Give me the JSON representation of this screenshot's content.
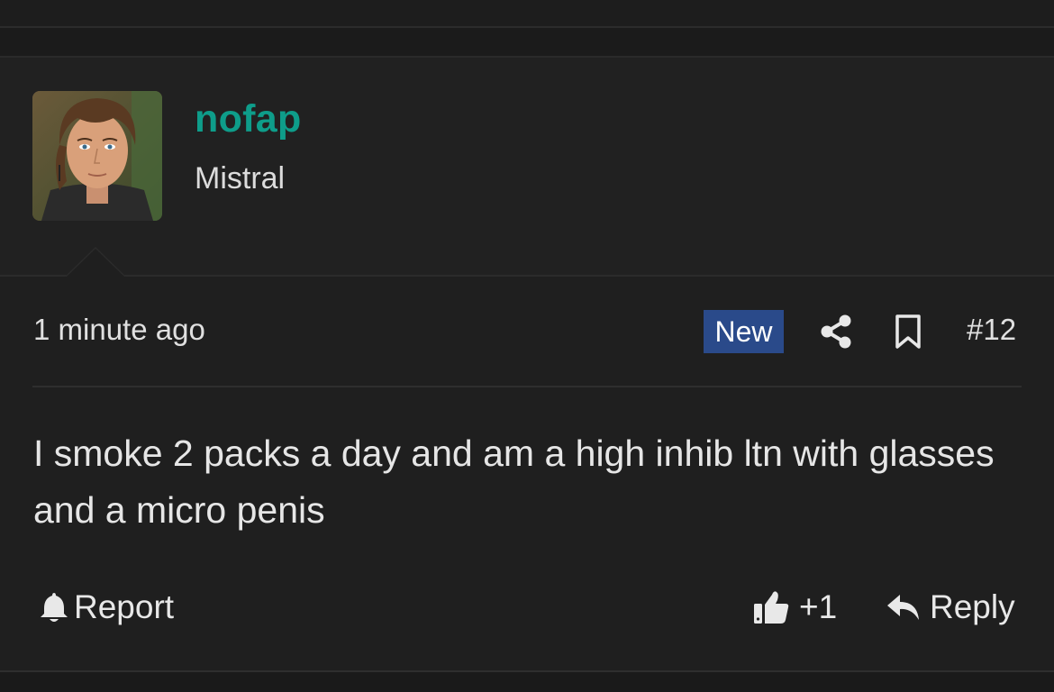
{
  "post": {
    "author": {
      "username": "nofap",
      "user_title": "Mistral",
      "avatar": "profile-photo"
    },
    "timestamp": "1 minute ago",
    "badge": "New",
    "post_number": "#12",
    "body": "I smoke 2 packs a day and am a high inhib ltn with glasses and a micro penis",
    "actions": {
      "report_label": "Report",
      "like_count": "+1",
      "reply_label": "Reply"
    }
  },
  "icons": {
    "share": "share-icon",
    "bookmark": "bookmark-icon",
    "report": "bell-icon",
    "like": "thumbs-up-icon",
    "reply": "reply-arrow-icon"
  },
  "colors": {
    "background": "#1f1f1f",
    "username": "#0e9d8a",
    "badge_bg": "#2a4a8a",
    "text": "#e6e6e6"
  }
}
